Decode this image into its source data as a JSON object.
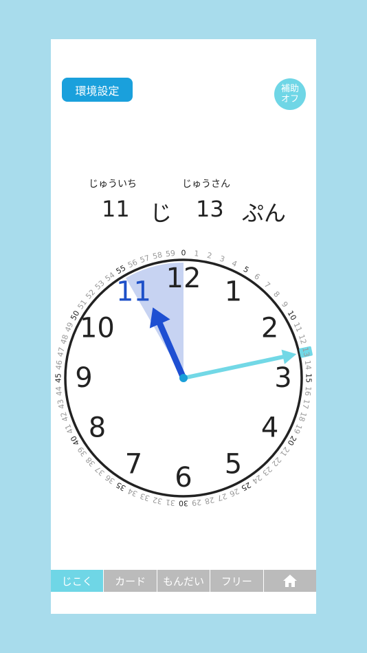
{
  "settings_label": "環境設定",
  "assist": {
    "line1": "補助",
    "line2": "オフ"
  },
  "time": {
    "hour_ruby": "じゅういち",
    "minute_ruby": "じゅうさん",
    "hour": "11",
    "hour_unit": "じ",
    "minute": "13",
    "minute_unit": "ぷん",
    "hour_value": 11,
    "minute_value": 13
  },
  "clock": {
    "hour_numbers": [
      "12",
      "1",
      "2",
      "3",
      "4",
      "5",
      "6",
      "7",
      "8",
      "9",
      "10",
      "11"
    ],
    "highlight_hour": "11",
    "colors": {
      "hour_hand": "#1e4fd2",
      "minute_hand": "#72d8e6",
      "sector": "#c7d3f2",
      "highlight": "#1e50c8",
      "minute_highlight_bg": "#72d8e6"
    }
  },
  "tabs": [
    {
      "label": "じこく",
      "active": true
    },
    {
      "label": "カード",
      "active": false
    },
    {
      "label": "もんだい",
      "active": false
    },
    {
      "label": "フリー",
      "active": false
    },
    {
      "label": "",
      "icon": "home-icon",
      "active": false
    }
  ]
}
